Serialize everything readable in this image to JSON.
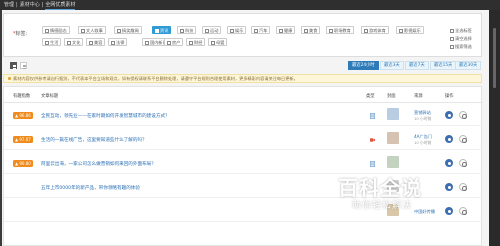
{
  "topbar": {
    "tabs": [
      "管理",
      "素材中心",
      "全网优质素材"
    ],
    "separator": "|",
    "active_index": 2
  },
  "filter": {
    "label_star": "*",
    "label_text": "标签:",
    "row1": [
      "情感励志",
      "文人轶事",
      "搞笑趣闻",
      "资讯",
      "科技",
      "运动",
      "娱乐",
      "汽车",
      "健康",
      "美食",
      "职场教育",
      "游戏体育",
      "影视娱乐"
    ],
    "row2": [
      "生活",
      "文化",
      "美容",
      "法律",
      "国内新闻",
      "房产",
      "财经",
      "母婴"
    ],
    "side_options": [
      "全选标签",
      "清空选择",
      "搜索筛选"
    ],
    "active_chip": "资讯"
  },
  "toolbar": {
    "time_tabs": [
      "最近24小时",
      "最近3天",
      "最近7天",
      "最近15天",
      "最近30天"
    ],
    "active_tab": "最近24小时"
  },
  "notice": {
    "text": "素材内容仅供参考请自行甄别，不代表本平台立场和观点，如有侵权请联系平台删除处理，请遵守平台规则合理使用素材，更多精彩内容请关注每日更新。"
  },
  "table": {
    "headers": {
      "hot": "有趣指数",
      "title": "文章标题",
      "type": "类型",
      "avatar": "封面",
      "source": "来源",
      "ops": "操作"
    },
    "rows": [
      {
        "badge": "96.86",
        "title": "全民互动，领先业——在家时期如何开发智慧城市的建设方式？",
        "type": "doc",
        "source": "营销驿站",
        "sub": "10 小时前"
      },
      {
        "badge": "97.07",
        "title": "生活的一篇在线广告，这里要知道些什么了解的吗？",
        "type": "video",
        "source": "4A广告门",
        "sub": "10 小时前"
      },
      {
        "badge": "90.80",
        "title": "阿里云出海，一家公司怎么做营销如何来回的外面布局？",
        "type": "doc",
        "source": "",
        "sub": ""
      },
      {
        "badge": "",
        "title": "五年上市0000年的新产品，带你领略有趣的体验",
        "type": "",
        "source": "",
        "sub": ""
      },
      {
        "badge": "",
        "title": "",
        "type": "",
        "source": "中国好传播",
        "sub": ""
      }
    ]
  },
  "watermark": {
    "big": "百科全说",
    "small": "助你轻松解决"
  },
  "colors": {
    "accent": "#2e9bd6",
    "badge": "#f08c1e",
    "link": "#2a6fb5"
  }
}
